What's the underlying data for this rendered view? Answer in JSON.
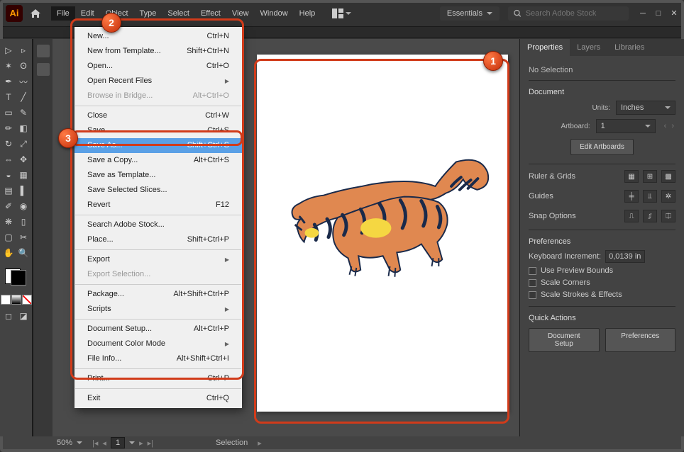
{
  "app": {
    "logo_text": "Ai"
  },
  "menubar": [
    "File",
    "Edit",
    "Object",
    "Type",
    "Select",
    "Effect",
    "View",
    "Window",
    "Help"
  ],
  "workspace": {
    "name": "Essentials"
  },
  "search": {
    "placeholder": "Search Adobe Stock"
  },
  "file_menu": {
    "items": [
      {
        "label": "New...",
        "shortcut": "Ctrl+N",
        "type": "item"
      },
      {
        "label": "New from Template...",
        "shortcut": "Shift+Ctrl+N",
        "type": "item"
      },
      {
        "label": "Open...",
        "shortcut": "Ctrl+O",
        "type": "item"
      },
      {
        "label": "Open Recent Files",
        "shortcut": "",
        "type": "sub"
      },
      {
        "label": "Browse in Bridge...",
        "shortcut": "Alt+Ctrl+O",
        "type": "item",
        "disabled": true
      },
      {
        "type": "sep"
      },
      {
        "label": "Close",
        "shortcut": "Ctrl+W",
        "type": "item"
      },
      {
        "label": "Save",
        "shortcut": "Ctrl+S",
        "type": "item"
      },
      {
        "label": "Save As...",
        "shortcut": "Shift+Ctrl+S",
        "type": "item",
        "hl": true
      },
      {
        "label": "Save a Copy...",
        "shortcut": "Alt+Ctrl+S",
        "type": "item"
      },
      {
        "label": "Save as Template...",
        "shortcut": "",
        "type": "item"
      },
      {
        "label": "Save Selected Slices...",
        "shortcut": "",
        "type": "item"
      },
      {
        "label": "Revert",
        "shortcut": "F12",
        "type": "item"
      },
      {
        "type": "sep"
      },
      {
        "label": "Search Adobe Stock...",
        "shortcut": "",
        "type": "item"
      },
      {
        "label": "Place...",
        "shortcut": "Shift+Ctrl+P",
        "type": "item"
      },
      {
        "type": "sep"
      },
      {
        "label": "Export",
        "shortcut": "",
        "type": "sub"
      },
      {
        "label": "Export Selection...",
        "shortcut": "",
        "type": "item",
        "disabled": true
      },
      {
        "type": "sep"
      },
      {
        "label": "Package...",
        "shortcut": "Alt+Shift+Ctrl+P",
        "type": "item"
      },
      {
        "label": "Scripts",
        "shortcut": "",
        "type": "sub"
      },
      {
        "type": "sep"
      },
      {
        "label": "Document Setup...",
        "shortcut": "Alt+Ctrl+P",
        "type": "item"
      },
      {
        "label": "Document Color Mode",
        "shortcut": "",
        "type": "sub"
      },
      {
        "label": "File Info...",
        "shortcut": "Alt+Shift+Ctrl+I",
        "type": "item"
      },
      {
        "type": "sep"
      },
      {
        "label": "Print...",
        "shortcut": "Ctrl+P",
        "type": "item"
      },
      {
        "type": "sep"
      },
      {
        "label": "Exit",
        "shortcut": "Ctrl+Q",
        "type": "item"
      }
    ]
  },
  "panel": {
    "tabs": [
      "Properties",
      "Layers",
      "Libraries"
    ],
    "no_selection": "No Selection",
    "document_hdr": "Document",
    "units_label": "Units:",
    "units_value": "Inches",
    "artboard_label": "Artboard:",
    "artboard_value": "1",
    "edit_artboards": "Edit Artboards",
    "ruler_hdr": "Ruler & Grids",
    "guides_hdr": "Guides",
    "snap_hdr": "Snap Options",
    "prefs_hdr": "Preferences",
    "kb_inc_label": "Keyboard Increment:",
    "kb_inc_value": "0,0139 in",
    "chk1": "Use Preview Bounds",
    "chk2": "Scale Corners",
    "chk3": "Scale Strokes & Effects",
    "qa_hdr": "Quick Actions",
    "qa_btn1": "Document Setup",
    "qa_btn2": "Preferences"
  },
  "status": {
    "zoom": "50%",
    "page": "1",
    "mode": "Selection"
  },
  "annot": {
    "b1": "1",
    "b2": "2",
    "b3": "3"
  }
}
